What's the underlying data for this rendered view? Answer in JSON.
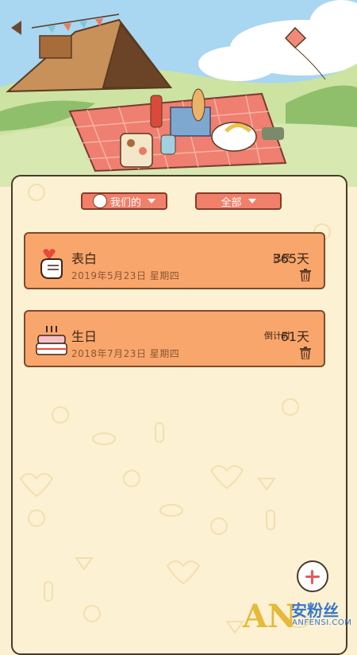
{
  "filters": {
    "mine_label": "我们的",
    "category_label": "全部"
  },
  "events": [
    {
      "title": "表白",
      "date": "2019年5月23日  星期四",
      "status": "已经",
      "days": "365天",
      "icon": "heart-hand-icon"
    },
    {
      "title": "生日",
      "date": "2018年7月23日  星期四",
      "status": "倒计时",
      "days": "61天",
      "icon": "birthday-cake-icon"
    }
  ],
  "watermark": {
    "logo": "AN",
    "name": "安粉丝",
    "url": "ANFENSI.COM"
  },
  "colors": {
    "card": "#f9a66c",
    "dropdown": "#f0806a",
    "panel": "#fcf1d3",
    "add_plus": "#e8595a"
  }
}
